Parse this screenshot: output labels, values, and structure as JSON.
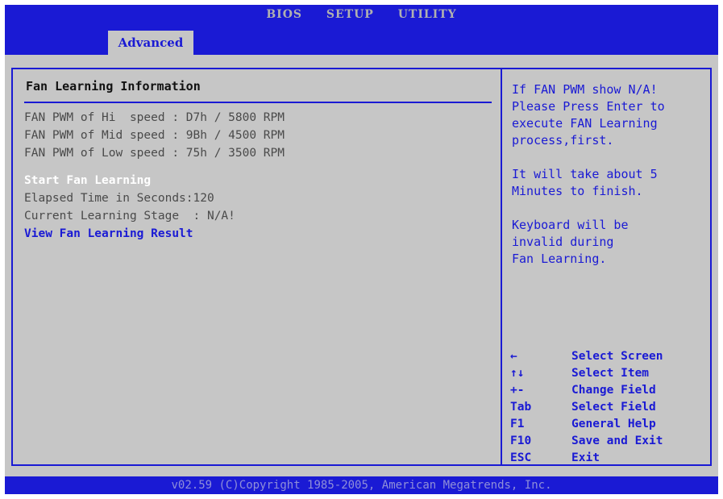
{
  "title_bar": {
    "items": [
      "BIOS",
      "SETUP",
      "UTILITY"
    ]
  },
  "tabs": [
    {
      "label": "Advanced"
    }
  ],
  "section": {
    "title": "Fan Learning Information",
    "fan_lines": [
      "FAN PWM of Hi  speed : D7h / 5800 RPM",
      "FAN PWM of Mid speed : 9Bh / 4500 RPM",
      "FAN PWM of Low speed : 75h / 3500 RPM"
    ],
    "start_item": "Start Fan Learning",
    "elapsed": "Elapsed Time in Seconds:120",
    "stage": "Current Learning Stage  : N/A!",
    "view_item": "View Fan Learning Result"
  },
  "help": {
    "paragraph_1": [
      "If FAN PWM show N/A!",
      "Please Press Enter to",
      "execute FAN Learning",
      "process,first."
    ],
    "paragraph_2": [
      "It will take about 5",
      "Minutes to finish."
    ],
    "paragraph_3": [
      "Keyboard will be",
      "invalid during",
      "Fan Learning."
    ]
  },
  "keys": [
    {
      "key": "←",
      "desc": "Select Screen"
    },
    {
      "key": "↑↓",
      "desc": "Select Item"
    },
    {
      "key": "+-",
      "desc": "Change Field"
    },
    {
      "key": "Tab",
      "desc": "Select Field"
    },
    {
      "key": "F1",
      "desc": "General Help"
    },
    {
      "key": "F10",
      "desc": "Save and Exit"
    },
    {
      "key": "ESC",
      "desc": "Exit"
    }
  ],
  "footer": "v02.59 (C)Copyright 1985-2005, American Megatrends, Inc.",
  "colors": {
    "accent_blue": "#1a1ad4",
    "panel_gray": "#c6c6c6",
    "text_gray": "#4a4a4a"
  }
}
